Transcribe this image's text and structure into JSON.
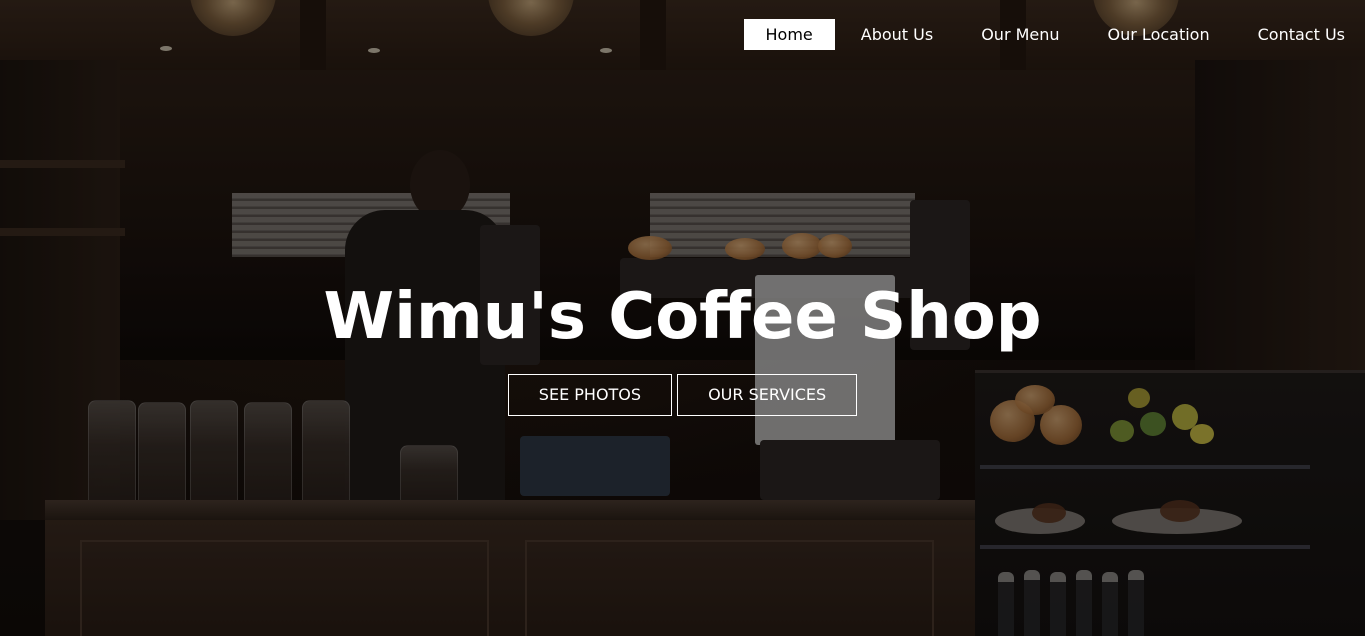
{
  "nav": {
    "items": [
      {
        "label": "Home",
        "active": true
      },
      {
        "label": "About Us",
        "active": false
      },
      {
        "label": "Our Menu",
        "active": false
      },
      {
        "label": "Our Location",
        "active": false
      },
      {
        "label": "Contact Us",
        "active": false
      }
    ]
  },
  "hero": {
    "title": "Wimu's Coffee Shop",
    "buttons": [
      {
        "label": "SEE PHOTOS"
      },
      {
        "label": "OUR SERVICES"
      }
    ]
  },
  "colors": {
    "nav_active_bg": "#ffffff",
    "nav_active_text": "#000000",
    "text": "#ffffff",
    "overlay": "rgba(0,0,0,0.38)"
  },
  "background_image": "dark coffee shop interior with barista, counter, pastry display case"
}
